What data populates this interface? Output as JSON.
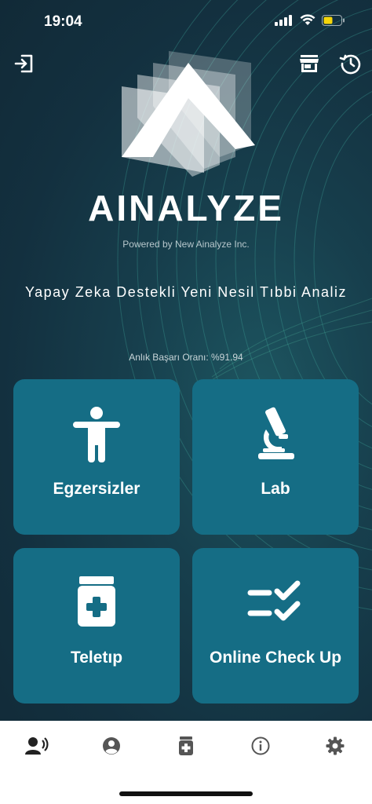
{
  "status": {
    "time": "19:04"
  },
  "brand": {
    "name": "AINALYZE",
    "powered_by": "Powered by New Ainalyze Inc.",
    "tagline": "Yapay Zeka Destekli Yeni Nesil Tıbbi Analiz",
    "success_rate": "Anlık Başarı Oranı: %91.94"
  },
  "cards": [
    {
      "label": "Egzersizler",
      "icon": "person-icon"
    },
    {
      "label": "Lab",
      "icon": "microscope-icon"
    },
    {
      "label": "Teletıp",
      "icon": "medicine-jar-icon"
    },
    {
      "label": "Online Check Up",
      "icon": "checklist-icon"
    }
  ],
  "colors": {
    "card": "#156d85",
    "background": "#13303f",
    "tab_icon": "#555555"
  },
  "tabs": [
    "voice-person-icon",
    "profile-icon",
    "medicine-icon",
    "info-icon",
    "settings-icon"
  ]
}
